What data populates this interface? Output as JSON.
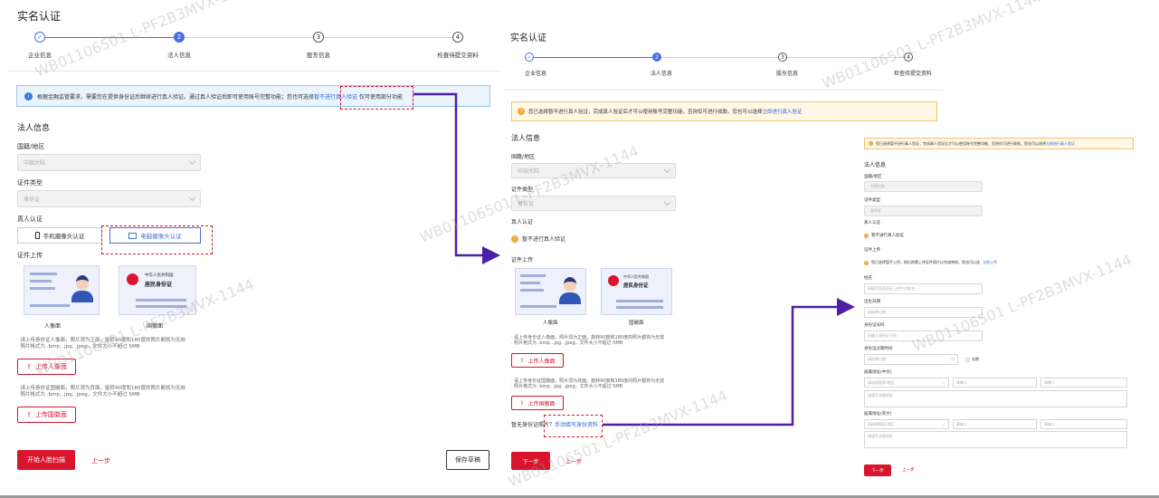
{
  "panel1": {
    "title": "实名认证",
    "steps": [
      "企业信息",
      "法人信息",
      "股东信息",
      "检查待提交资料"
    ],
    "step_numbers": [
      "2",
      "3",
      "4"
    ],
    "notice": "根据金融监管要求，需要您在提供身份证后继续进行真人验证。通过真人验证后即可使用账号完整功能；您也可选择",
    "notice_link": "暂不进行真人验证",
    "notice_tail": "仅可使用部分功能",
    "section": "法人信息",
    "country_label": "国籍/地区",
    "country_value": "中国大陆",
    "idtype_label": "证件类型",
    "idtype_value": "身份证",
    "verify_label": "真人认证",
    "verify_mobile": "手机摄像头认证",
    "verify_pc": "电脑摄像头认证",
    "upload_label": "证件上传",
    "card_front": "人像面",
    "card_back": "国徽面",
    "card_cn_title": "中华人民共和国",
    "card_cn_sub": "居民身份证",
    "hint_front": [
      "· 请上传身份证人像面，照片须为正面，旋转90度和180度的照片都将为无效",
      "· 照片格式为 .bmp, .jpg, .jpeg，文件大小不超过 5MB"
    ],
    "btn_front": "上传人像面",
    "hint_back": [
      "· 请上传身份证国徽面，照片须为背面，旋转90度和180度的照片都将为无效",
      "· 照片格式为 .bmp, .jpg, .jpeg，文件大小不超过 5MB"
    ],
    "btn_back": "上传国徽面",
    "btn_start": "开始人脸扫描",
    "btn_prev": "上一步",
    "btn_save": "保存草稿"
  },
  "panel2": {
    "title": "实名认证",
    "steps": [
      "企业信息",
      "法人信息",
      "股东信息",
      "检查待提交资料"
    ],
    "step_numbers": [
      "2",
      "3",
      "4"
    ],
    "notice": "您已选择暂不进行真人验证，完成真人验证后才可以使用账号完整功能，否则仅可进行收款。您也可以选择",
    "notice_link": "立即进行真人验证",
    "section": "法人信息",
    "country_label": "国籍/地区",
    "country_value": "中国大陆",
    "idtype_label": "证件类型",
    "idtype_value": "身份证",
    "verify_label": "真人认证",
    "verify_status": "暂不进行真人验证",
    "upload_label": "证件上传",
    "card_front": "人像面",
    "card_back": "国徽面",
    "card_cn_title": "中华人民共和国",
    "card_cn_sub": "居民身份证",
    "hint_front": [
      "· 请上传身份证人像面，照片须为正面，旋转90度和180度的照片都将为无效",
      "· 照片格式为 .bmp, .jpg, .jpeg，文件大小不超过 5MB"
    ],
    "btn_front": "上传人像面",
    "hint_back": [
      "· 请上传身份证国徽面，照片须为背面，旋转90度和180度的照片都将为无效",
      "· 照片格式为 .bmp, .jpg, .jpeg，文件大小不超过 5MB"
    ],
    "btn_back": "上传国徽面",
    "no_id_text": "暂无身份证照片？",
    "no_id_link": "手动填写身份资料",
    "btn_next": "下一步",
    "btn_prev": "上一步"
  },
  "panel3": {
    "notice": "您已选择暂不进行真人验证，完成真人验证后才可以使用账号完整功能，否则仅可进行收款。您也可以选择",
    "notice_link": "立即进行真人验证",
    "section": "法人信息",
    "country_label": "国籍/地区",
    "country_value": "中国大陆",
    "idtype_label": "证件类型",
    "idtype_value": "身份证",
    "verify_label": "真人认证",
    "verify_status": "暂不进行真人验证",
    "upload_label": "证件上传",
    "upload_notice": "您已选择暂不上传，稍后的需上传证件照片以完成审核，您也可以选",
    "upload_link": "立即上传",
    "name_label": "姓名",
    "name_ph": "请填写您身份证上的中文姓名",
    "birth_label": "出生日期",
    "birth_ph": "请选择日期",
    "idno_label": "身份证号码",
    "idno_ph": "请输入身份证号码",
    "expire_label": "身份证过期时间",
    "expire_ph": "请选择日期",
    "longterm": "长期",
    "addr_cn_label": "居属地址(中文)",
    "addr_region_ph": "请选择国家/地区",
    "addr_input_ph": "请输入",
    "addr_detail_ph": "请填写详细地址",
    "addr_en_label": "居属地址(英文)",
    "btn_next": "下一步",
    "btn_prev": "上一步"
  },
  "watermark": "WB01106501 L-PF2B3MVX-1144",
  "colors": {
    "accent": "#4a6ee0",
    "brand_red": "#d9152d",
    "arrow": "#4b1fa8",
    "warn": "#f2a63b"
  }
}
